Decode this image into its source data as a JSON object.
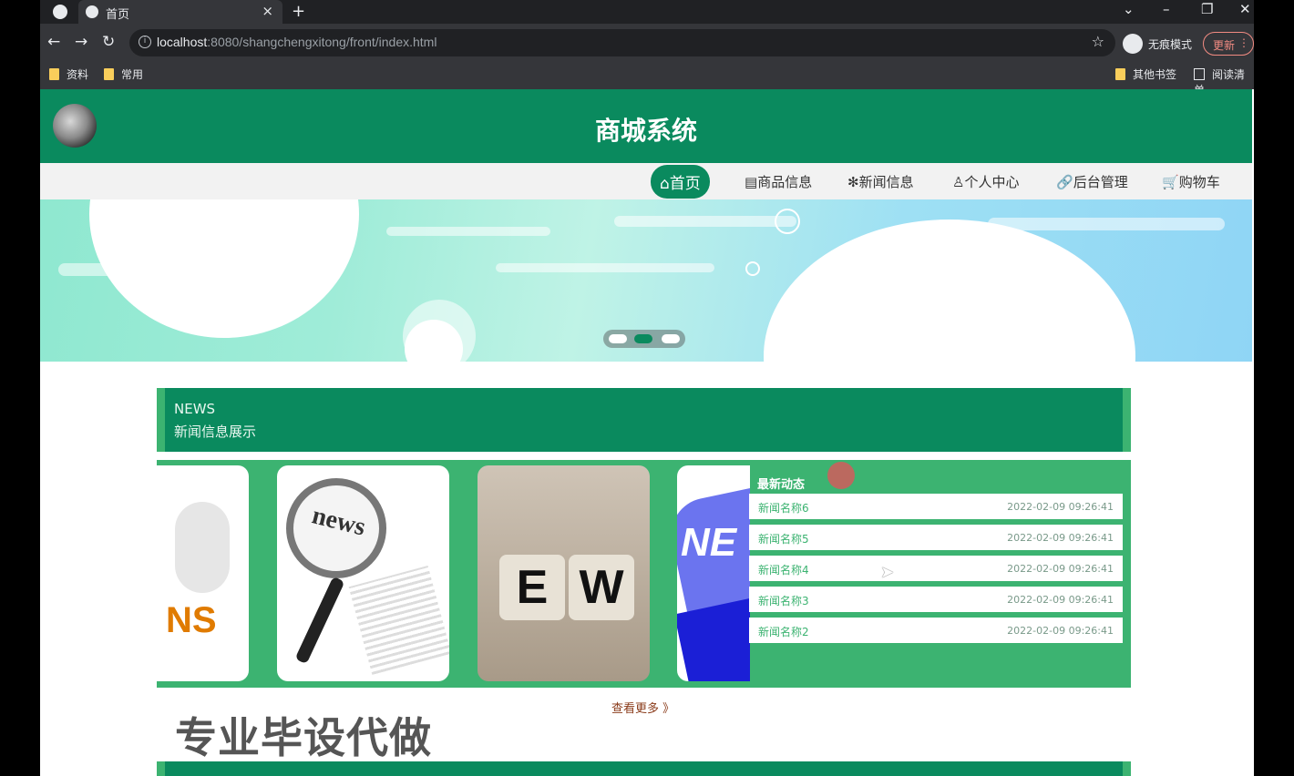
{
  "browser": {
    "tab_title": "首页",
    "close_glyph": "×",
    "new_tab_glyph": "+",
    "url_host": "localhost",
    "url_path": ":8080/shangchengxitong/front/index.html",
    "incognito_label": "无痕模式",
    "update_label": "更新",
    "bookmarks": [
      "资料",
      "常用"
    ],
    "other_bookmarks": "其他书签",
    "reading_list": "阅读清单",
    "icons": [
      "back-icon",
      "forward-icon",
      "reload-icon",
      "info-icon",
      "star-icon",
      "incognito-icon",
      "menu-icon",
      "minimize-icon",
      "restore-icon",
      "close-icon",
      "dropdown-icon"
    ]
  },
  "site": {
    "title": "商城系统",
    "nav": [
      {
        "label": "首页",
        "icon": "⌂",
        "active": true
      },
      {
        "label": "商品信息",
        "icon": "▤"
      },
      {
        "label": "新闻信息",
        "icon": "✻"
      },
      {
        "label": "个人中心",
        "icon": "♙"
      },
      {
        "label": "后台管理",
        "icon": "🔗"
      },
      {
        "label": "购物车",
        "icon": "🛒"
      }
    ],
    "brand_color": "#0a8a5e",
    "accent_color": "#3cb371"
  },
  "banner": {
    "active_slide": 2,
    "slide_count": 3
  },
  "news": {
    "heading_en": "NEWS",
    "heading_cn": "新闻信息展示",
    "latest_title": "最新动态",
    "items": [
      {
        "name": "新闻名称6",
        "time": "2022-02-09 09:26:41"
      },
      {
        "name": "新闻名称5",
        "time": "2022-02-09 09:26:41"
      },
      {
        "name": "新闻名称4",
        "time": "2022-02-09 09:26:41"
      },
      {
        "name": "新闻名称3",
        "time": "2022-02-09 09:26:41"
      },
      {
        "name": "新闻名称2",
        "time": "2022-02-09 09:26:41"
      }
    ],
    "thumb_texts": [
      "NS",
      "news",
      "E",
      "W",
      "NE"
    ],
    "more_label": "查看更多 》"
  },
  "watermark": "专业毕设代做"
}
